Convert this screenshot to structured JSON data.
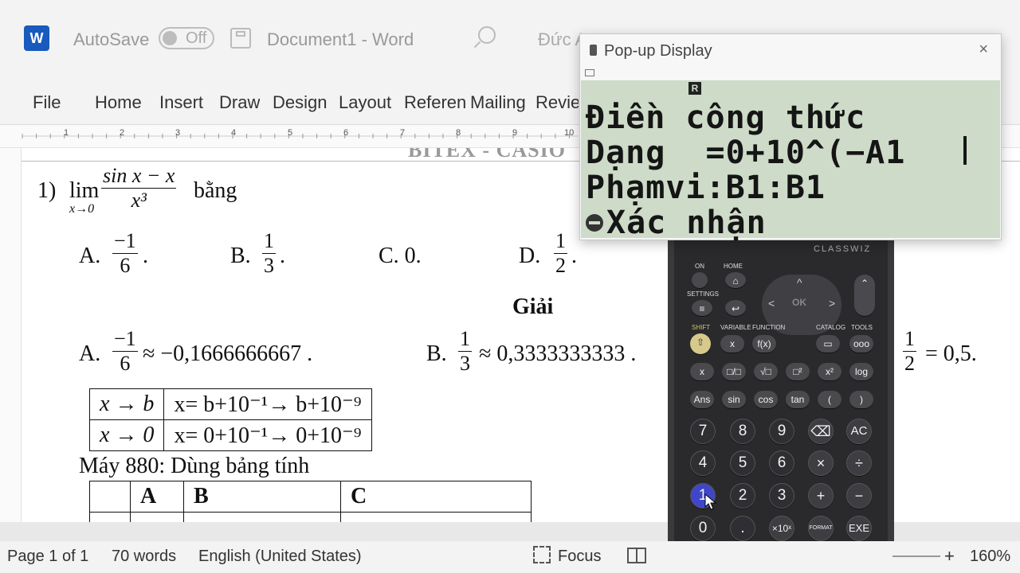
{
  "titlebar": {
    "app_logo": "W",
    "autosave_label": "AutoSave",
    "autosave_state": "Off",
    "document_title": "Document1  -  Word",
    "user_name": "Đức A"
  },
  "ribbon": {
    "tabs": [
      "File",
      "Home",
      "Insert",
      "Draw",
      "Design",
      "Layout",
      "Referen",
      "Mailing",
      "Revie"
    ]
  },
  "ruler": {
    "numbers": [
      "1",
      "1",
      "2",
      "3",
      "4",
      "5",
      "6",
      "7",
      "8",
      "9",
      "10"
    ]
  },
  "document": {
    "header_fragment": "BITEX - CASIO",
    "q1": {
      "label": "1)",
      "lim": "lim",
      "lim_sub": "x→0",
      "num": "sin x − x",
      "den": "x³",
      "tail": "bằng"
    },
    "answers": {
      "a_label": "A.",
      "a_num": "−1",
      "a_den": "6",
      "a_dot": ".",
      "b_label": "B.",
      "b_num": "1",
      "b_den": "3",
      "b_dot": ".",
      "c_text": "C. 0.",
      "d_label": "D.",
      "d_num": "1",
      "d_den": "2",
      "d_dot": "."
    },
    "solution_heading": "Giải",
    "solution": {
      "a_label": "A.",
      "a_num": "−1",
      "a_den": "6",
      "a_approx": "≈ −0,1666666667 .",
      "b_label": "B.",
      "b_num": "1",
      "b_den": "3",
      "b_approx": "≈ 0,3333333333 .",
      "d_num": "1",
      "d_den": "2",
      "d_value": "= 0,5."
    },
    "table1": [
      [
        "x → b",
        "x= b+10⁻¹→ b+10⁻⁹"
      ],
      [
        "x → 0",
        "x= 0+10⁻¹→ 0+10⁻⁹"
      ]
    ],
    "machine_line": "Máy 880: Dùng bảng tính",
    "table2_headers": [
      "",
      "A",
      "B",
      "C"
    ]
  },
  "popup": {
    "title": "Pop-up Display",
    "close": "×",
    "indicator": "R",
    "lines": [
      "Điền công thức",
      "Dạng  =0+10^(−A1",
      "Phạmvi:B1:B1",
      "Xác nhận"
    ]
  },
  "calculator": {
    "brand": "CLASSWIZ",
    "top_labels": [
      "ON",
      "HOME",
      "SETTINGS",
      "SHIFT",
      "VARIABLE",
      "FUNCTION",
      "CATALOG",
      "TOOLS"
    ],
    "row_fn1": [
      "x",
      "□/□",
      "√□",
      "□²",
      "x²",
      "log"
    ],
    "row_fn2": [
      "Ans",
      "sin",
      "cos",
      "tan",
      "(",
      ")"
    ],
    "row1": [
      "7",
      "8",
      "9",
      "⌫",
      "AC"
    ],
    "row2": [
      "4",
      "5",
      "6",
      "×",
      "÷"
    ],
    "row3": [
      "1",
      "2",
      "3",
      "+",
      "−"
    ],
    "row4": [
      "0",
      ".",
      "×10ˣ",
      "FORMAT",
      "EXE"
    ],
    "fx": "f(x)",
    "dots": "ooo"
  },
  "statusbar": {
    "page": "Page 1 of 1",
    "words": "70 words",
    "language": "English (United States)",
    "focus": "Focus",
    "zoom": "160%"
  }
}
